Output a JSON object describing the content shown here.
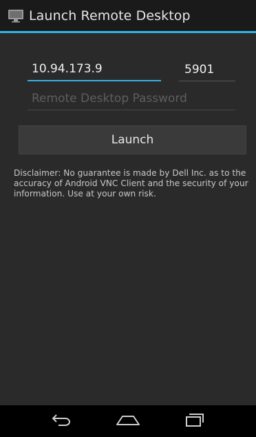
{
  "app": {
    "title": "Launch Remote Desktop",
    "icon": "monitor-icon"
  },
  "form": {
    "host_value": "10.94.173.9",
    "port_value": "5901",
    "password_value": "",
    "password_placeholder": "Remote Desktop Password",
    "launch_label": "Launch"
  },
  "disclaimer": "Disclaimer: No guarantee is made by Dell Inc. as to the accuracy of Android VNC Client and the security of your information. Use at your own risk.",
  "nav": {
    "back_icon": "back-icon",
    "home_icon": "home-icon",
    "recents_icon": "recents-icon"
  },
  "colors": {
    "accent": "#33b5e5",
    "background": "#2a2a2a",
    "action_bar": "#1a1a1a"
  }
}
